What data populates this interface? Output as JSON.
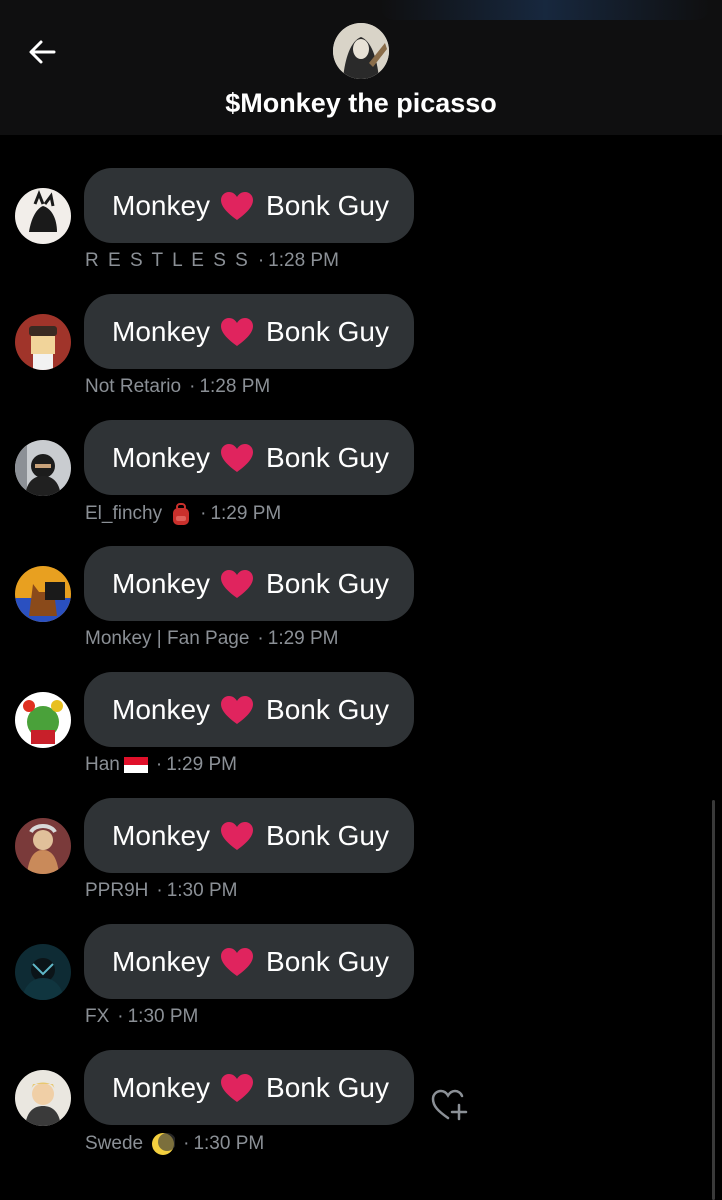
{
  "header": {
    "title": "$Monkey the picasso",
    "back_icon": "arrow-left-icon"
  },
  "messages": [
    {
      "w1": "Monkey",
      "w2": "Bonk Guy",
      "sender": "R E S T L E S S",
      "time": "1:28 PM"
    },
    {
      "w1": "Monkey",
      "w2": "Bonk Guy",
      "sender": "Not Retario",
      "time": "1:28 PM"
    },
    {
      "w1": "Monkey",
      "w2": "Bonk Guy",
      "sender": "El_finchy",
      "time": "1:29 PM"
    },
    {
      "w1": "Monkey",
      "w2": "Bonk Guy",
      "sender": "Monkey | Fan Page",
      "time": "1:29 PM"
    },
    {
      "w1": "Monkey",
      "w2": "Bonk Guy",
      "sender": "Han",
      "time": "1:29 PM"
    },
    {
      "w1": "Monkey",
      "w2": "Bonk Guy",
      "sender": "PPR9H",
      "time": "1:30 PM"
    },
    {
      "w1": "Monkey",
      "w2": "Bonk Guy",
      "sender": "FX",
      "time": "1:30 PM"
    },
    {
      "w1": "Monkey",
      "w2": "Bonk Guy",
      "sender": "Swede",
      "time": "1:30 PM"
    }
  ],
  "separator": "·",
  "react_icon": "heart-add-icon",
  "colors": {
    "background": "#000000",
    "bubble": "#2f3336",
    "meta_text": "#8b9096",
    "heart": "#e0245e"
  }
}
